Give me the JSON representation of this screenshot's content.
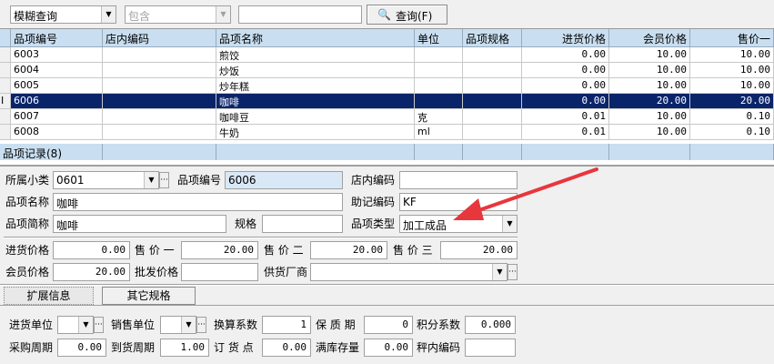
{
  "toolbar": {
    "mode_value": "模糊查询",
    "match_value": "包含",
    "search_value": "",
    "search_button": "查询(F)"
  },
  "grid": {
    "headers": [
      "品项编号",
      "店内编码",
      "品项名称",
      "单位",
      "品项规格",
      "进货价格",
      "会员价格",
      "售价一"
    ],
    "rows": [
      [
        "6003",
        "",
        "煎饺",
        "",
        "",
        "0.00",
        "10.00",
        "10.00"
      ],
      [
        "6004",
        "",
        "炒饭",
        "",
        "",
        "0.00",
        "10.00",
        "10.00"
      ],
      [
        "6005",
        "",
        "炒年糕",
        "",
        "",
        "0.00",
        "10.00",
        "10.00"
      ],
      [
        "6006",
        "",
        "咖啡",
        "",
        "",
        "0.00",
        "20.00",
        "20.00"
      ],
      [
        "6007",
        "",
        "咖啡豆",
        "克",
        "",
        "0.01",
        "10.00",
        "0.10"
      ],
      [
        "6008",
        "",
        "牛奶",
        "ml",
        "",
        "0.01",
        "10.00",
        "0.10"
      ]
    ],
    "selected_row_index": 3,
    "row_indicator": "I",
    "footer": "品项记录(8)"
  },
  "form": {
    "category_label": "所属小类",
    "category_value": "0601",
    "item_code_label": "品项编号",
    "item_code_value": "6006",
    "store_code_label": "店内编码",
    "store_code_value": "",
    "item_name_label": "品项名称",
    "item_name_value": "咖啡",
    "mnemonic_label": "助记编码",
    "mnemonic_value": "KF",
    "short_name_label": "品项简称",
    "short_name_value": "咖啡",
    "spec_label": "规格",
    "spec_value": "",
    "item_type_label": "品项类型",
    "item_type_value": "加工成品",
    "purchase_price_label": "进货价格",
    "purchase_price_value": "0.00",
    "price1_label": "售 价 一",
    "price1_value": "20.00",
    "price2_label": "售 价 二",
    "price2_value": "20.00",
    "price3_label": "售 价 三",
    "price3_value": "20.00",
    "member_price_label": "会员价格",
    "member_price_value": "20.00",
    "wholesale_label": "批发价格",
    "wholesale_value": "",
    "supplier_label": "供货厂商",
    "supplier_value": ""
  },
  "tabs": {
    "ext_info": "扩展信息",
    "other_spec": "其它规格"
  },
  "ext": {
    "purchase_unit_label": "进货单位",
    "purchase_unit_value": "",
    "sales_unit_label": "销售单位",
    "sales_unit_value": "",
    "conversion_label": "换算系数",
    "conversion_value": "1",
    "shelf_life_label": "保 质 期",
    "shelf_life_value": "0",
    "points_label": "积分系数",
    "points_value": "0.000",
    "purchase_cycle_label": "采购周期",
    "purchase_cycle_value": "0.00",
    "arrival_cycle_label": "到货周期",
    "arrival_cycle_value": "1.00",
    "reorder_label": "订 货 点",
    "reorder_value": "0.00",
    "max_stock_label": "满库存量",
    "max_stock_value": "0.00",
    "category_code_label": "秤内编码",
    "category_code_value": ""
  },
  "colors": {
    "selection": "#0a246a",
    "header": "#c9dff1",
    "arrow": "#e8363d"
  }
}
